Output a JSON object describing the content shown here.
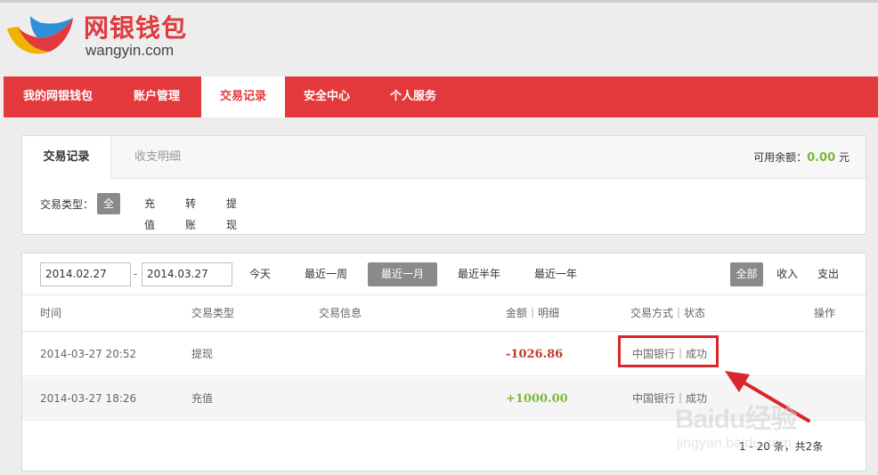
{
  "logo": {
    "cn": "网银钱包",
    "en": "wangyin.com"
  },
  "nav": [
    {
      "label": "我的网银钱包"
    },
    {
      "label": "账户管理"
    },
    {
      "label": "交易记录",
      "active": true
    },
    {
      "label": "安全中心"
    },
    {
      "label": "个人服务"
    }
  ],
  "subtabs": [
    {
      "label": "交易记录",
      "active": true
    },
    {
      "label": "收支明细"
    }
  ],
  "balance": {
    "label": "可用余额：",
    "amount": "0.00",
    "unit": "元"
  },
  "filter": {
    "label": "交易类型：",
    "options": [
      "全部",
      "充值",
      "转账",
      "提现"
    ],
    "selected": "全部"
  },
  "date_range": {
    "start": "2014.02.27",
    "separator": "-",
    "end": "2014.03.27"
  },
  "ranges": [
    "今天",
    "最近一周",
    "最近一月",
    "最近半年",
    "最近一年"
  ],
  "range_selected": "最近一月",
  "flow_filter": [
    "全部",
    "收入",
    "支出"
  ],
  "table": {
    "headers": [
      "时间",
      "交易类型",
      "交易信息",
      "金额｜明细",
      "交易方式｜状态",
      "操作"
    ],
    "rows": [
      {
        "time": "2014-03-27 20:52",
        "type": "提现",
        "info": "",
        "amount": "-1026.86",
        "method": "中国银行｜成功"
      },
      {
        "time": "2014-03-27 18:26",
        "type": "充值",
        "info": "",
        "amount": "+1000.00",
        "method": "中国银行｜成功"
      }
    ]
  },
  "pagination": "1 - 20 条，共2条",
  "watermark": {
    "brand": "Baidu经验",
    "sub": "jingyan.baidu.com"
  },
  "colors": {
    "brand_red": "#e3393c",
    "positive": "#7cb83a",
    "negative": "#c0392b",
    "annotation": "#d9262b"
  }
}
